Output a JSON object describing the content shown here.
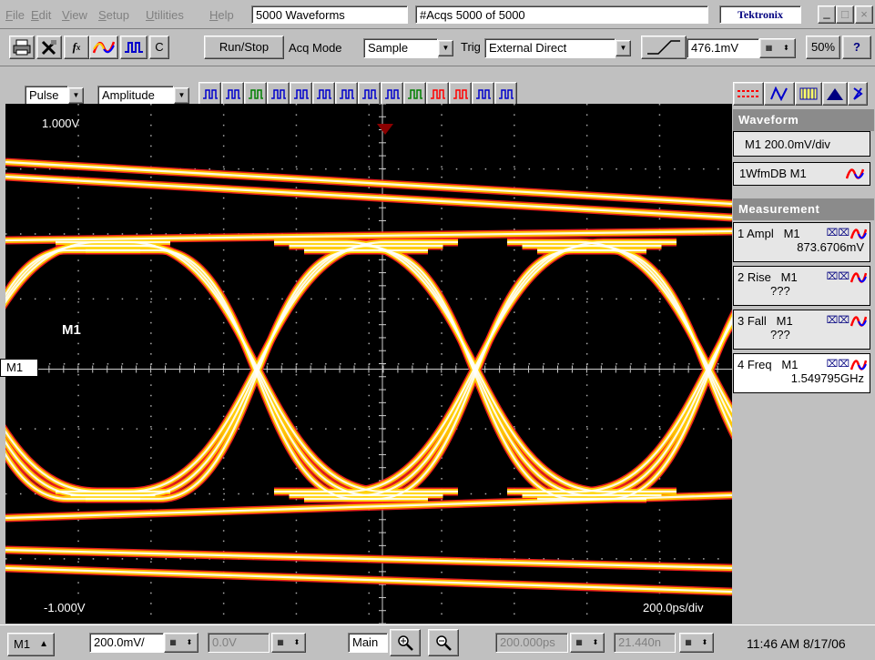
{
  "menu": [
    "File",
    "Edit",
    "View",
    "Setup",
    "Utilities",
    "Help"
  ],
  "title_field": "5000 Waveforms",
  "acqs_field": "#Acqs  5000 of 5000",
  "brand": "Tektronix",
  "window_buttons": [
    "_",
    "□",
    "×"
  ],
  "toolbar1": {
    "c_label": "C",
    "run_stop": "Run/Stop",
    "acq_mode_label": "Acq Mode",
    "acq_mode_value": "Sample",
    "trig_label": "Trig",
    "trig_value": "External Direct",
    "trig_level": "476.1mV",
    "trig_percent": "50%",
    "help_label": "?"
  },
  "toolbar2": {
    "pulse_value": "Pulse",
    "amplitude_value": "Amplitude"
  },
  "scope": {
    "top_level": "1.000V",
    "bottom_level": "-1.000V",
    "timebase": "200.0ps/div",
    "channel_label": "M1",
    "left_marker": "M1"
  },
  "side": {
    "waveform_header": "Waveform",
    "waveform_scale": "M1 200.0mV/div",
    "wfmdb": "1WfmDB M1",
    "measurement_header": "Measurement",
    "measurements": [
      {
        "name": "1 Ampl   M1",
        "value": "873.6706mV"
      },
      {
        "name": "2 Rise   M1",
        "value": "???"
      },
      {
        "name": "3 Fall   M1",
        "value": "???"
      },
      {
        "name": "4 Freq   M1",
        "value": "1.549795GHz"
      }
    ]
  },
  "bottom": {
    "channel": "M1",
    "scale": "200.0mV/",
    "offset": "0.0V",
    "main": "Main",
    "position": "200.000ps",
    "record": "21.440n",
    "clock": "11:46 AM 8/17/06"
  }
}
